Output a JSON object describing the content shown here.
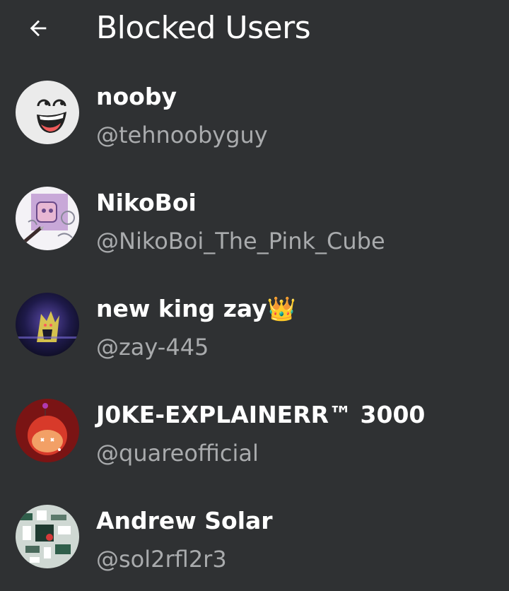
{
  "header": {
    "back_icon": "arrow-left-icon",
    "title": "Blocked Users"
  },
  "users": [
    {
      "name": "nooby",
      "handle": "@tehnoobyguy",
      "avatar": "smiley-face-avatar"
    },
    {
      "name": "NikoBoi",
      "handle": "@NikoBoi_The_Pink_Cube",
      "avatar": "pink-cube-drawing-avatar"
    },
    {
      "name": "new king zay👑",
      "handle": "@zay-445",
      "avatar": "dark-purple-glow-avatar"
    },
    {
      "name": "J0KE-EXPLAINERR™ 3000",
      "handle": "@quareofficial",
      "avatar": "red-character-avatar"
    },
    {
      "name": "Andrew Solar",
      "handle": "@sol2rfl2r3",
      "avatar": "noisy-collage-avatar"
    }
  ],
  "colors": {
    "background": "#2f3133",
    "text_primary": "#ffffff",
    "text_secondary": "#a9abad"
  }
}
